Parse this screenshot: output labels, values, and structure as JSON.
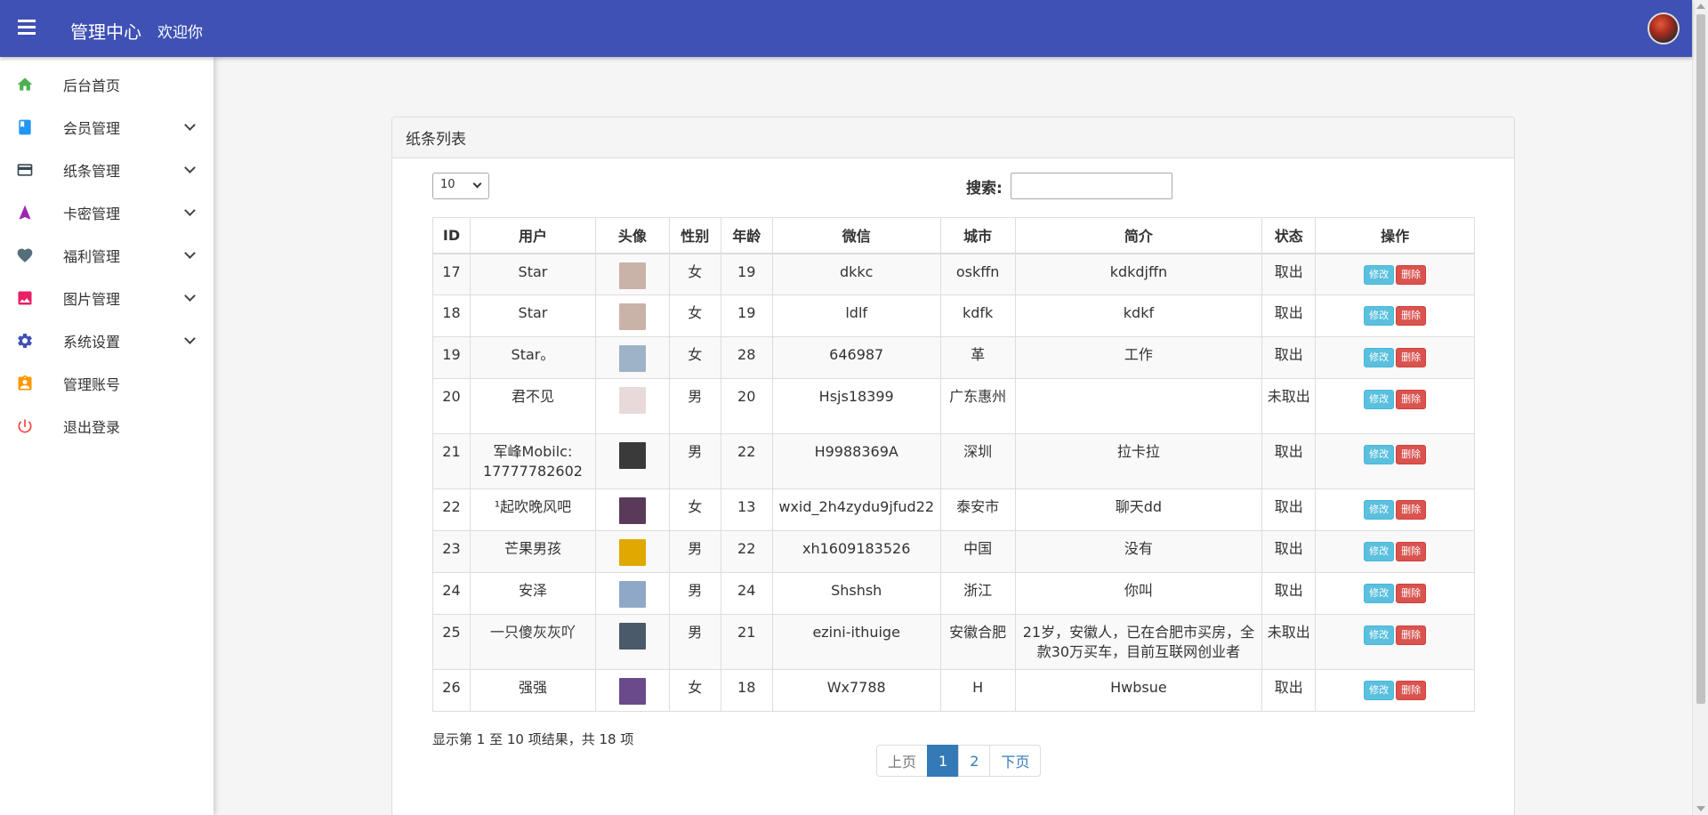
{
  "header": {
    "brand": "管理中心",
    "welcome": "欢迎你"
  },
  "sidebar": {
    "items": [
      {
        "label": "后台首页",
        "icon": "home-icon",
        "color": "#4caf50",
        "expandable": false
      },
      {
        "label": "会员管理",
        "icon": "book-icon",
        "color": "#2196f3",
        "expandable": true
      },
      {
        "label": "纸条管理",
        "icon": "card-icon",
        "color": "#37474f",
        "expandable": true
      },
      {
        "label": "卡密管理",
        "icon": "navigation-icon",
        "color": "#9c27b0",
        "expandable": true
      },
      {
        "label": "福利管理",
        "icon": "heart-icon",
        "color": "#546e7a",
        "expandable": true
      },
      {
        "label": "图片管理",
        "icon": "image-icon",
        "color": "#e91e63",
        "expandable": true
      },
      {
        "label": "系统设置",
        "icon": "gear-icon",
        "color": "#3f51b5",
        "expandable": true
      },
      {
        "label": "管理账号",
        "icon": "badge-icon",
        "color": "#ff9800",
        "expandable": false
      },
      {
        "label": "退出登录",
        "icon": "power-icon",
        "color": "#f44336",
        "expandable": false
      }
    ]
  },
  "panel": {
    "title": "纸条列表",
    "page_size": "10",
    "search_label": "搜索:",
    "search_value": ""
  },
  "table": {
    "headers": [
      "ID",
      "用户",
      "头像",
      "性别",
      "年龄",
      "微信",
      "城市",
      "简介",
      "状态",
      "操作"
    ],
    "edit_label": "修改",
    "delete_label": "删除",
    "rows": [
      {
        "id": "17",
        "user": "Star",
        "avatar": "#c9b2a8",
        "gender": "女",
        "age": "19",
        "wechat": "dkkc",
        "city": "oskffn",
        "intro": "kdkdjffn",
        "status": "取出"
      },
      {
        "id": "18",
        "user": "Star",
        "avatar": "#c9b2a8",
        "gender": "女",
        "age": "19",
        "wechat": "ldlf",
        "city": "kdfk",
        "intro": "kdkf",
        "status": "取出"
      },
      {
        "id": "19",
        "user": "Star。",
        "avatar": "#9fb3c8",
        "gender": "女",
        "age": "28",
        "wechat": "646987",
        "city": "革",
        "intro": "工作",
        "status": "取出"
      },
      {
        "id": "20",
        "user": "君不见",
        "avatar": "#e8dada",
        "gender": "男",
        "age": "20",
        "wechat": "Hsjs18399",
        "city": "广东惠州",
        "intro": "",
        "status": "未取出"
      },
      {
        "id": "21",
        "user": "军峰Mobilc: 17777782602",
        "avatar": "#3a3a3a",
        "gender": "男",
        "age": "22",
        "wechat": "H9988369A",
        "city": "深圳",
        "intro": "拉卡拉",
        "status": "取出"
      },
      {
        "id": "22",
        "user": "¹起吹晚风吧",
        "avatar": "#5a3a5a",
        "gender": "女",
        "age": "13",
        "wechat": "wxid_2h4zydu9jfud22",
        "city": "泰安市",
        "intro": "聊天dd",
        "status": "取出"
      },
      {
        "id": "23",
        "user": "芒果男孩",
        "avatar": "#e0a800",
        "gender": "男",
        "age": "22",
        "wechat": "xh1609183526",
        "city": "中国",
        "intro": "没有",
        "status": "取出"
      },
      {
        "id": "24",
        "user": "安泽",
        "avatar": "#8fa8c8",
        "gender": "男",
        "age": "24",
        "wechat": "Shshsh",
        "city": "浙江",
        "intro": "你叫",
        "status": "取出"
      },
      {
        "id": "25",
        "user": "一只傻灰灰吖",
        "avatar": "#4a5a6a",
        "gender": "男",
        "age": "21",
        "wechat": "ezini-ithuige",
        "city": "安徽合肥",
        "intro": "21岁，安徽人，已在合肥市买房，全款30万买车，目前互联网创业者",
        "status": "未取出"
      },
      {
        "id": "26",
        "user": "强强",
        "avatar": "#6a4a8a",
        "gender": "女",
        "age": "18",
        "wechat": "Wx7788",
        "city": "H",
        "intro": "Hwbsue",
        "status": "取出"
      }
    ]
  },
  "footer": {
    "info": "显示第 1 至 10 项结果，共 18 项",
    "pager": {
      "prev": "上页",
      "pages": [
        "1",
        "2"
      ],
      "current": "1",
      "next": "下页"
    }
  }
}
